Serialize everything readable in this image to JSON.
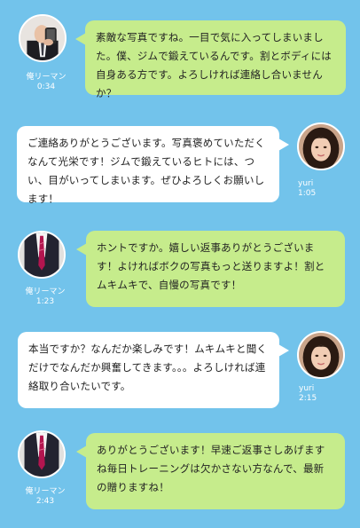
{
  "messages": [
    {
      "side": "left",
      "sender": "俺リーマン",
      "time": "0:34",
      "avatar": "man-with-phone-avatar",
      "text": "素敵な写真ですね。一目で気に入ってしまいました。僕、ジムで鍛えているんです。割とボディには自身ある方です。よろしければ連絡し合いませんか？"
    },
    {
      "side": "right",
      "sender": "yuri",
      "time": "1:05",
      "avatar": "woman-avatar",
      "text": "ご連絡ありがとうございます。写真褒めていただくなんて光栄です！ジムで鍛えているヒトには、つい、目がいってしまいます。ぜひよろしくお願いします！"
    },
    {
      "side": "left",
      "sender": "俺リーマン",
      "time": "1:23",
      "avatar": "man-in-suit-avatar",
      "text": "ホントですか。嬉しい返事ありがとうございます！よければボクの写真もっと送りますよ！割とムキムキで、自慢の写真です！"
    },
    {
      "side": "right",
      "sender": "yuri",
      "time": "2:15",
      "avatar": "woman-avatar",
      "text": "本当ですか？なんだか楽しみです！ムキムキと聞くだけでなんだか興奮してきます。。。よろしければ連絡取り合いたいです。"
    },
    {
      "side": "left",
      "sender": "俺リーマン",
      "time": "2:43",
      "avatar": "man-in-suit-avatar",
      "text": "ありがとうございます！早速ご返事さしあげますね毎日トレーニングは欠かさない方なんで、最新の贈りますね！"
    }
  ]
}
